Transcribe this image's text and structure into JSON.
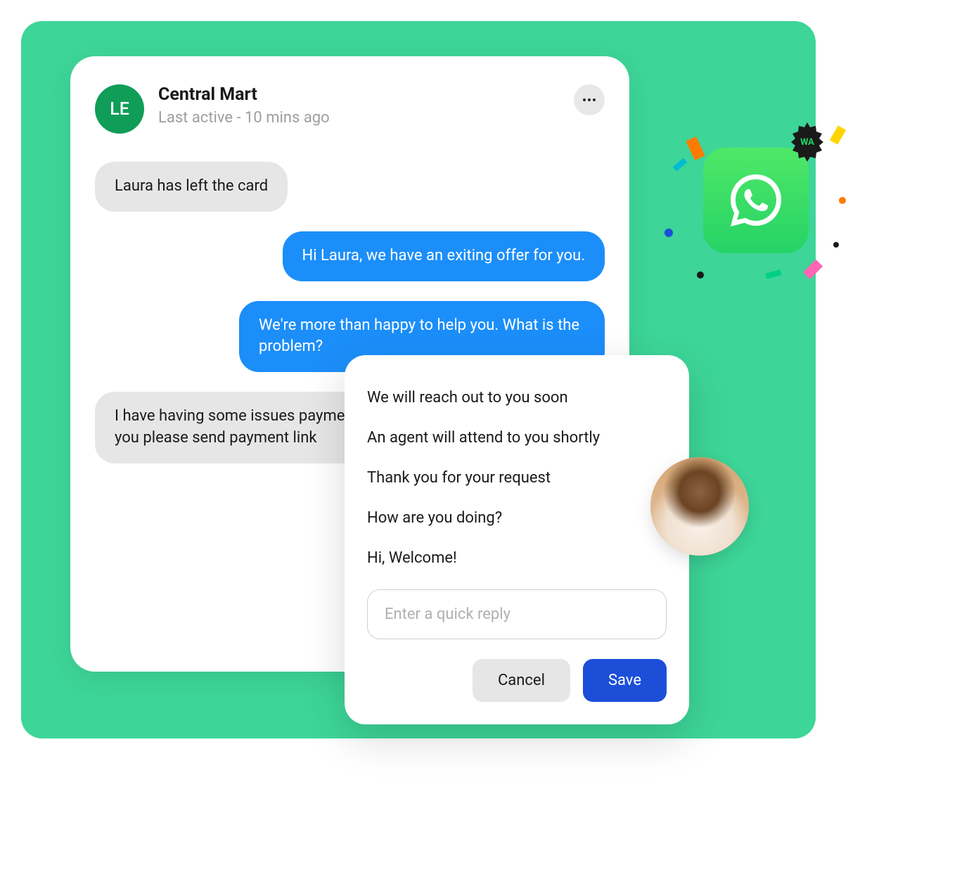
{
  "header": {
    "avatar_initials": "LE",
    "contact_name": "Central Mart",
    "last_active": "Last active - 10 mins ago"
  },
  "messages": {
    "system_1": "Laura has left the card",
    "out_1": "Hi Laura, we have an exiting offer for you.",
    "out_2": "We're more than happy to help you. What is the problem?",
    "in_1": "I have having some issues payment can you please send payment link"
  },
  "quick_reply": {
    "options": [
      "We will reach out to you soon",
      "An agent will attend to you shortly",
      "Thank you for your request",
      "How are you doing?",
      "Hi, Welcome!"
    ],
    "input_placeholder": "Enter a quick reply",
    "cancel_label": "Cancel",
    "save_label": "Save"
  },
  "whatsapp": {
    "badge_text": "WA"
  }
}
